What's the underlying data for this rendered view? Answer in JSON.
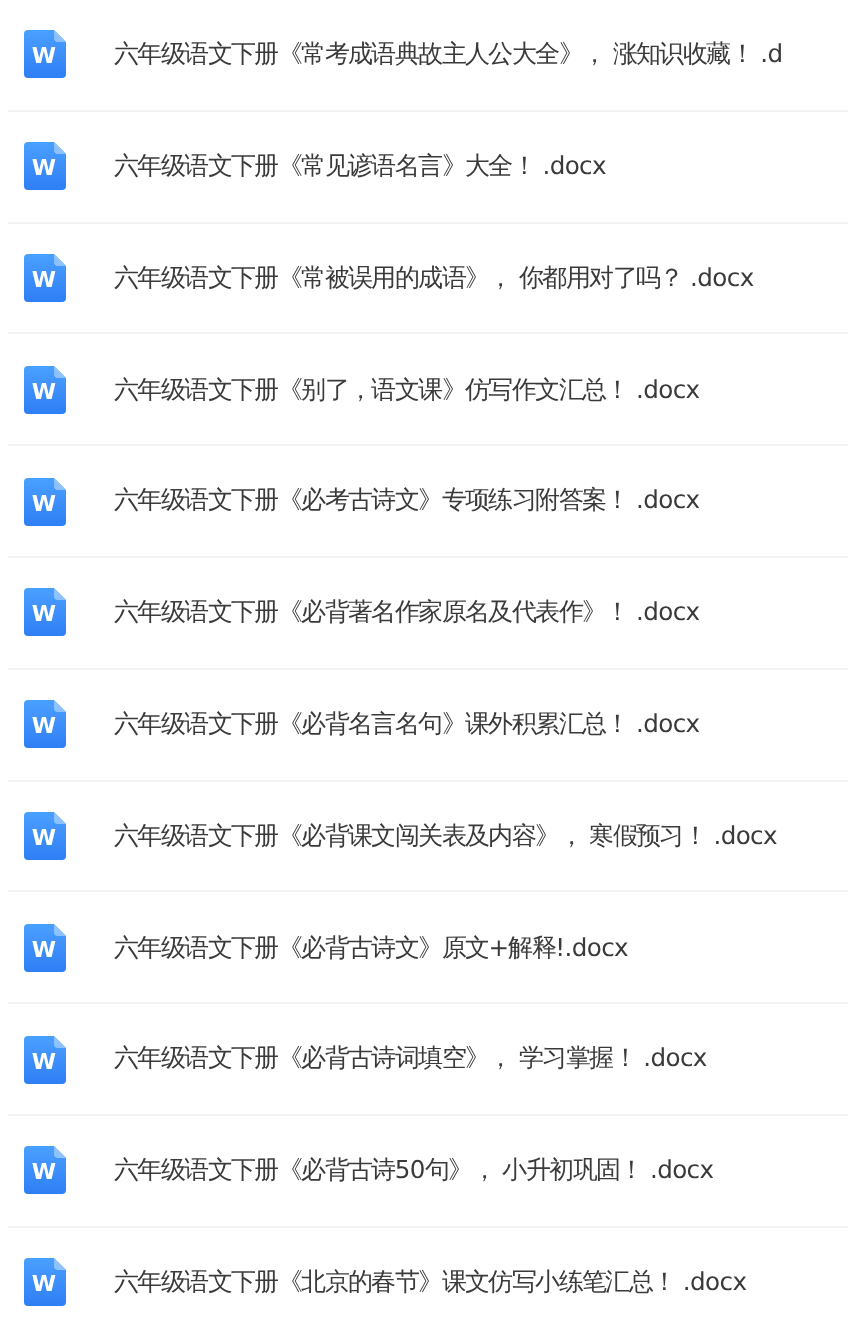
{
  "files": [
    {
      "icon_label": "W",
      "name": "六年级语文下册《常考成语典故主人公大全》， 涨知识收藏！ .d"
    },
    {
      "icon_label": "W",
      "name": "六年级语文下册《常见谚语名言》大全！ .docx"
    },
    {
      "icon_label": "W",
      "name": "六年级语文下册《常被误用的成语》， 你都用对了吗？ .docx"
    },
    {
      "icon_label": "W",
      "name": "六年级语文下册《别了，语文课》仿写作文汇总！ .docx"
    },
    {
      "icon_label": "W",
      "name": "六年级语文下册《必考古诗文》专项练习附答案！ .docx"
    },
    {
      "icon_label": "W",
      "name": "六年级语文下册《必背著名作家原名及代表作》！ .docx"
    },
    {
      "icon_label": "W",
      "name": "六年级语文下册《必背名言名句》课外积累汇总！ .docx"
    },
    {
      "icon_label": "W",
      "name": "六年级语文下册《必背课文闯关表及内容》， 寒假预习！ .docx"
    },
    {
      "icon_label": "W",
      "name": "六年级语文下册《必背古诗文》原文+解释!.docx"
    },
    {
      "icon_label": "W",
      "name": "六年级语文下册《必背古诗词填空》， 学习掌握！ .docx"
    },
    {
      "icon_label": "W",
      "name": "六年级语文下册《必背古诗50句》， 小升初巩固！ .docx"
    },
    {
      "icon_label": "W",
      "name": "六年级语文下册《北京的春节》课文仿写小练笔汇总！ .docx"
    }
  ]
}
